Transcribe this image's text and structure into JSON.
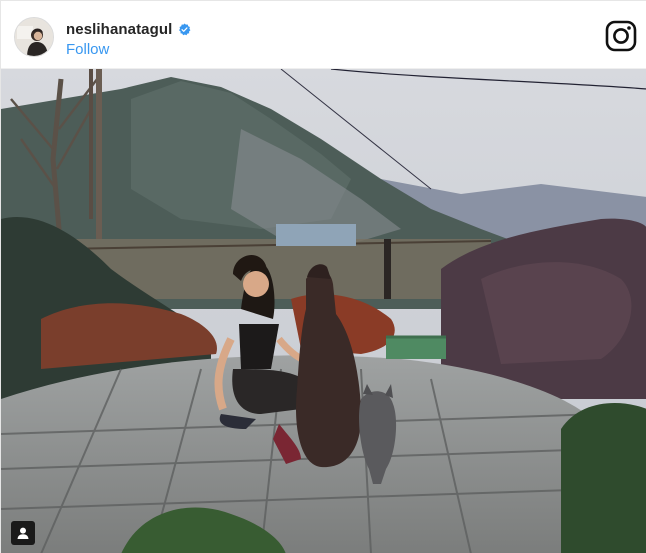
{
  "header": {
    "username": "neslihanatagul",
    "verified": true,
    "follow_label": "Follow"
  },
  "icons": {
    "avatar": "profile-photo",
    "verified": "verified-badge-icon",
    "instagram": "instagram-logo-icon",
    "media_badge": "tagged-user-icon"
  },
  "colors": {
    "follow_link": "#3897f0",
    "verified_badge": "#3897f0",
    "username": "#262626"
  }
}
